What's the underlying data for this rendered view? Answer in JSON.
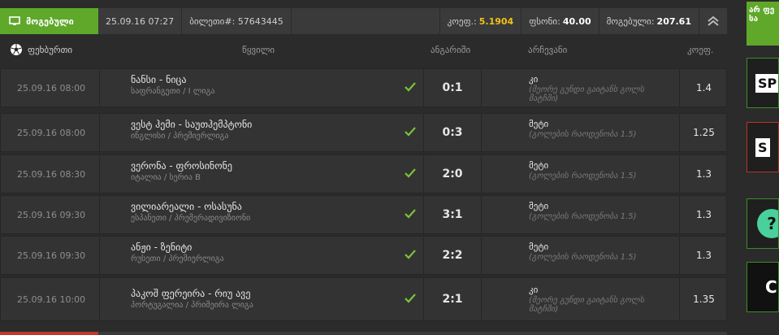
{
  "header": {
    "status_label": "მოგებული",
    "datetime": "25.09.16 07:27",
    "ticket_label": "ბილეთი#:",
    "ticket_number": "57643445",
    "coef_label": "კოეფ.:",
    "coef_value": "5.1904",
    "stake_label": "ფსონი:",
    "stake_value": "40.00",
    "win_label": "მოგებული:",
    "win_value": "207.61"
  },
  "columns": {
    "sport": "ფეხბურთი",
    "event": "წყვილი",
    "score": "ანგარიში",
    "selection": "არჩევანი",
    "odds": "კოეფ."
  },
  "rows": [
    {
      "date": "25.09.16 08:00",
      "match": "ნანსი - ნიცა",
      "league": "საფრანგეთი / I ლიგა",
      "score": "0:1",
      "pick": "კი",
      "pick_desc": "(მეორე გუნდი გაიტანს გოლს მატჩში)",
      "odds": "1.4"
    },
    {
      "date": "25.09.16 08:00",
      "match": "ვესტ ჰემი - საუთჰემპტონი",
      "league": "ინგლისი / პრემიერლიგა",
      "score": "0:3",
      "pick": "მეტი",
      "pick_desc": "(გოლების რაოდენობა 1.5)",
      "odds": "1.25"
    },
    {
      "date": "25.09.16 08:30",
      "match": "ვერონა - ფროსინონე",
      "league": "იტალია / სერია B",
      "score": "2:0",
      "pick": "მეტი",
      "pick_desc": "(გოლების რაოდენობა 1.5)",
      "odds": "1.3"
    },
    {
      "date": "25.09.16 09:30",
      "match": "ვილიარეალი - ოსასუნა",
      "league": "ესპანეთი / პრემერადივიზიონი",
      "score": "3:1",
      "pick": "მეტი",
      "pick_desc": "(გოლების რაოდენობა 1.5)",
      "odds": "1.3"
    },
    {
      "date": "25.09.16 09:30",
      "match": "ანჟი - ზენიტი",
      "league": "რუსეთი / პრემიერლიგა",
      "score": "2:2",
      "pick": "მეტი",
      "pick_desc": "(გოლების რაოდენობა 1.5)",
      "odds": "1.3"
    },
    {
      "date": "25.09.16 10:00",
      "match": "პაკოშ ფერეირა - რიუ ავე",
      "league": "პორტუგალია / პრიმეირა ლიგა",
      "score": "2:1",
      "pick": "კი",
      "pick_desc": "(მეორე გუნდი გაიტანს გოლს მატჩში)",
      "odds": "1.35"
    }
  ],
  "sidebar": {
    "ad1_text": "არ ფე სა",
    "ad2_text": "SP",
    "ad3_text": "S",
    "ad4_text": "?",
    "ad5_text": "C"
  },
  "colors": {
    "accent_green": "#5fa82a",
    "coef_yellow": "#f2c21a",
    "check_green": "#7cc33a"
  },
  "icons": {
    "status": "monitor-icon",
    "collapse": "chevron-up-double-icon",
    "sport": "soccer-ball-icon",
    "row_status": "checkmark-icon"
  }
}
